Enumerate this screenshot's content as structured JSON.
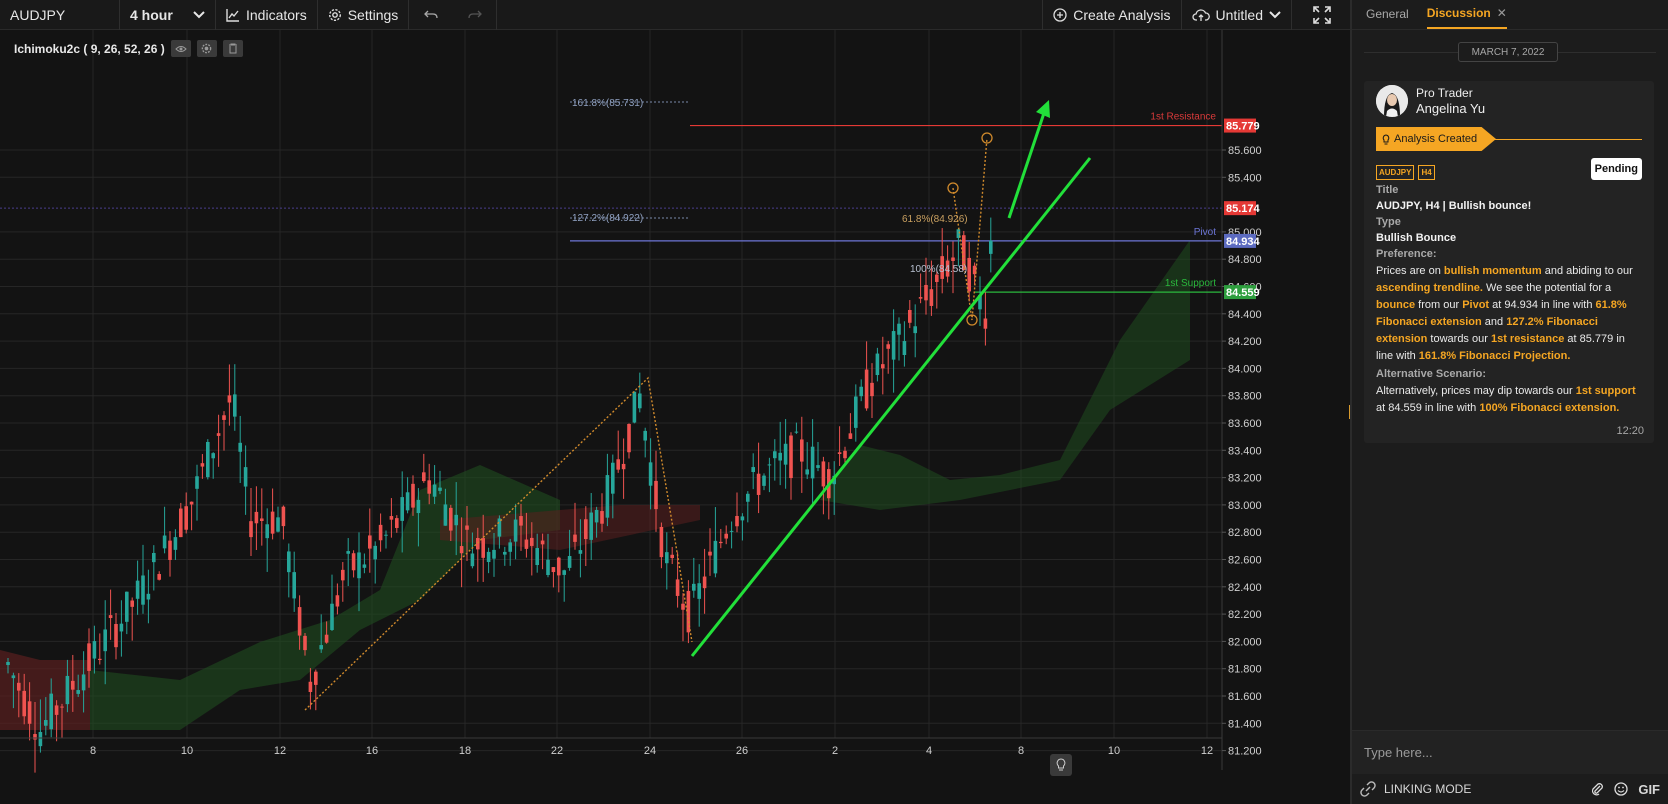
{
  "toolbar": {
    "symbol": "AUDJPY",
    "interval": "4 hour",
    "indicators": "Indicators",
    "settings": "Settings",
    "create_analysis": "Create Analysis",
    "layout_name": "Untitled"
  },
  "chart": {
    "indicator_legend": "Ichimoku2c ( 9, 26, 52, 26 )",
    "price_labels": [
      "85.600",
      "85.400",
      "85.000",
      "84.800",
      "84.600",
      "84.400",
      "84.200",
      "84.000",
      "83.800",
      "83.600",
      "83.400",
      "83.200",
      "83.000",
      "82.800",
      "82.600",
      "82.400",
      "82.200",
      "82.000",
      "81.800",
      "81.600",
      "81.400",
      "81.200"
    ],
    "price_ticks": [
      85.6,
      85.4,
      85.0,
      84.8,
      84.6,
      84.4,
      84.2,
      84.0,
      83.8,
      83.6,
      83.4,
      83.2,
      83.0,
      82.8,
      82.6,
      82.4,
      82.2,
      82.0,
      81.8,
      81.6,
      81.4,
      81.2
    ],
    "date_labels": [
      "8",
      "10",
      "12",
      "16",
      "18",
      "22",
      "24",
      "26",
      "2",
      "4",
      "8",
      "10",
      "12"
    ],
    "badges": [
      {
        "value": "85.779",
        "color": "#e53935"
      },
      {
        "value": "85.174",
        "color": "#e53935"
      },
      {
        "value": "84.934",
        "color": "#5c6bc0"
      },
      {
        "value": "84.559",
        "color": "#2e9e3e"
      }
    ],
    "levels": {
      "resistance": {
        "label": "1st Resistance",
        "value": 85.779
      },
      "pivot": {
        "label": "Pivot",
        "value": 84.934
      },
      "support": {
        "label": "1st Support",
        "value": 84.559
      }
    },
    "fib_labels": {
      "proj_161": "161.8%(85.731)",
      "proj_127": "127.2%(84.922)",
      "ext_61": "61.8%(84.926)",
      "ext_100": "100%(84.58)"
    },
    "colors": {
      "bull": "#26a69a",
      "bear": "#ef5350",
      "trendline": "#22e03a",
      "fib": "#d08a2c",
      "cloud_green": "#1f4d1f",
      "cloud_red": "#5a1f1f"
    }
  },
  "panel": {
    "tabs": [
      "General",
      "Discussion"
    ],
    "active_tab": "Discussion",
    "date": "MARCH 7, 2022",
    "author_role": "Pro Trader",
    "author_name": "Angelina Yu",
    "status": "Analysis Created",
    "tags": [
      "AUDJPY",
      "H4"
    ],
    "pending": "Pending",
    "title_label": "Title",
    "title_value": "AUDJPY, H4 | Bullish bounce!",
    "type_label": "Type",
    "type_value": "Bullish Bounce",
    "preference_label": "Preference:",
    "pref": {
      "t1": "Prices are on ",
      "h1": "bullish momentum",
      "t2": " and abiding to our ",
      "h2": "ascending trendline.",
      "t3": " We see the potential for a ",
      "h3": "bounce",
      "t4": " from our ",
      "h4": "Pivot",
      "t5": " at 94.934 in line with ",
      "h5": "61.8% Fibonacci extension",
      "t6": " and ",
      "h6": "127.2% Fibonacci extension",
      "t7": " towards our ",
      "h7": "1st resistance",
      "t8": " at 85.779 in line with ",
      "h8": "161.8% Fibonacci Projection."
    },
    "alt_label": "Alternative Scenario:",
    "alt": {
      "t1": "Alternatively, prices may dip towards our ",
      "h1": "1st support",
      "t2": " at 84.559 in line with ",
      "h2": "100% Fibonacci extension."
    },
    "time": "12:20",
    "input_placeholder": "Type here...",
    "linking_mode": "LINKING MODE",
    "gif": "GIF"
  }
}
